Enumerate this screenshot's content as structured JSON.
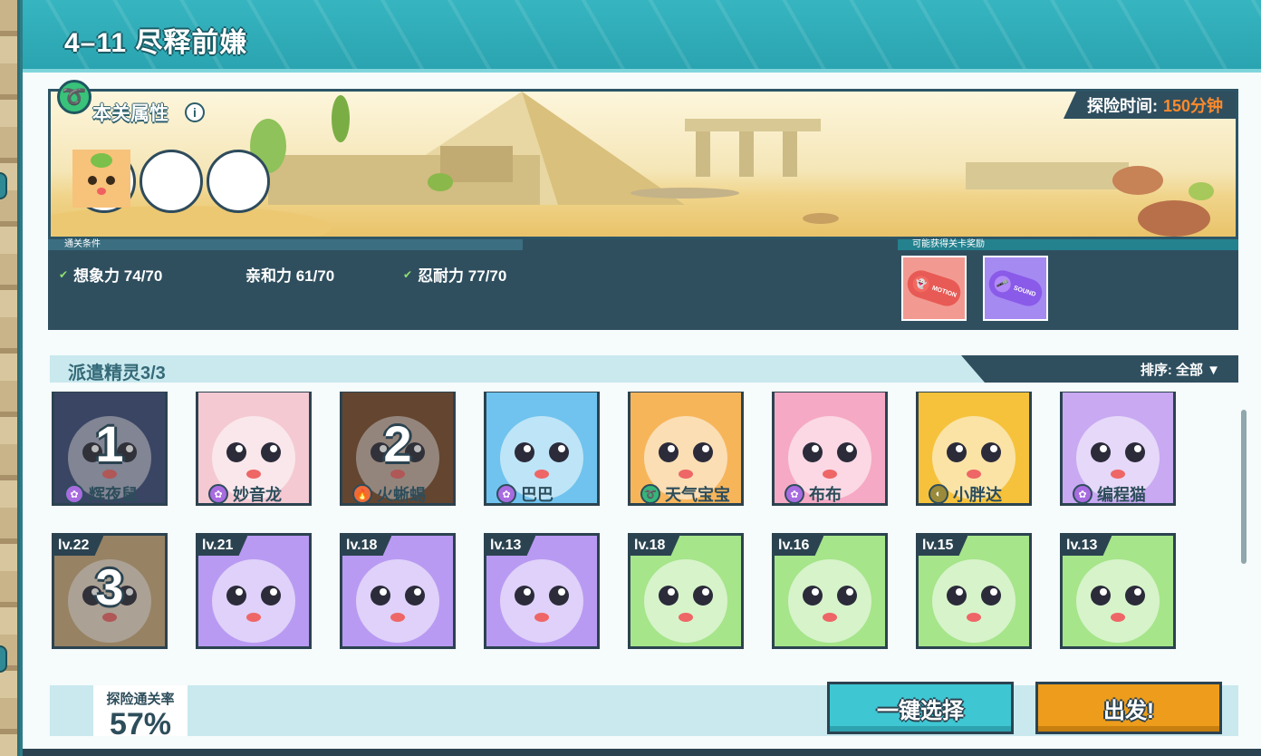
{
  "level": {
    "title": "4–11 尽释前嫌"
  },
  "attributes": {
    "title": "本关属性",
    "info_icon": "i",
    "time_label": "探险时间:",
    "time_value": "150分钟",
    "pets": [
      "dark-night-pet",
      "fire-bird-pet",
      "leaf-fox-pet"
    ]
  },
  "conditions": {
    "label": "通关条件",
    "items": [
      {
        "text": "想象力 74/70",
        "met": true
      },
      {
        "text": "亲和力 61/70",
        "met": false
      },
      {
        "text": "忍耐力 77/70",
        "met": true
      }
    ]
  },
  "rewards": {
    "label": "可能获得关卡奖励",
    "items": [
      {
        "tag": "MOTION",
        "icon": "ghost-icon",
        "color": "#f07a78"
      },
      {
        "tag": "SOUND",
        "icon": "microphone-icon",
        "color": "#9b6cf0"
      }
    ]
  },
  "dispatch": {
    "title": "派遣精灵3/3",
    "sort_label": "排序: 全部 ▼"
  },
  "pets": [
    {
      "name": "辉夜鼠",
      "element": "light",
      "slot": "1",
      "level": "",
      "bg": "#3a4a7a"
    },
    {
      "name": "妙音龙",
      "element": "light",
      "slot": "",
      "level": "",
      "bg": "#f4c9d2"
    },
    {
      "name": "火蜥蜴",
      "element": "fire",
      "slot": "2",
      "level": "",
      "bg": "#7a4a2a"
    },
    {
      "name": "巴巴",
      "element": "light",
      "slot": "",
      "level": "",
      "bg": "#6fc3ee"
    },
    {
      "name": "天气宝宝",
      "element": "wind",
      "slot": "",
      "level": "",
      "bg": "#f7b55a"
    },
    {
      "name": "布布",
      "element": "light",
      "slot": "",
      "level": "",
      "bg": "#f6a9c4"
    },
    {
      "name": "小胖达",
      "element": "earth",
      "slot": "",
      "level": "",
      "bg": "#f6c23b"
    },
    {
      "name": "编程猫",
      "element": "light",
      "slot": "",
      "level": "",
      "bg": "#c8a9f2"
    },
    {
      "name": "",
      "element": "",
      "slot": "3",
      "level": "lv.22",
      "bg": "#c8a87a"
    },
    {
      "name": "",
      "element": "",
      "slot": "",
      "level": "lv.21",
      "bg": "#b99af2"
    },
    {
      "name": "",
      "element": "",
      "slot": "",
      "level": "lv.18",
      "bg": "#b99af2"
    },
    {
      "name": "",
      "element": "",
      "slot": "",
      "level": "lv.13",
      "bg": "#b99af2"
    },
    {
      "name": "",
      "element": "",
      "slot": "",
      "level": "lv.18",
      "bg": "#a6e58a"
    },
    {
      "name": "",
      "element": "",
      "slot": "",
      "level": "lv.16",
      "bg": "#a6e58a"
    },
    {
      "name": "",
      "element": "",
      "slot": "",
      "level": "lv.15",
      "bg": "#a6e58a"
    },
    {
      "name": "",
      "element": "",
      "slot": "",
      "level": "lv.13",
      "bg": "#a6e58a"
    }
  ],
  "stats": {
    "rate_label": "探险通关率",
    "rate_value": "57%"
  },
  "buttons": {
    "auto_select": "一键选择",
    "go": "出发!"
  },
  "colors": {
    "light": "#a86ce0",
    "fire": "#f06a3a",
    "wind": "#36b57a",
    "earth": "#9a8a3a",
    "accent": "#ff8a2b"
  }
}
